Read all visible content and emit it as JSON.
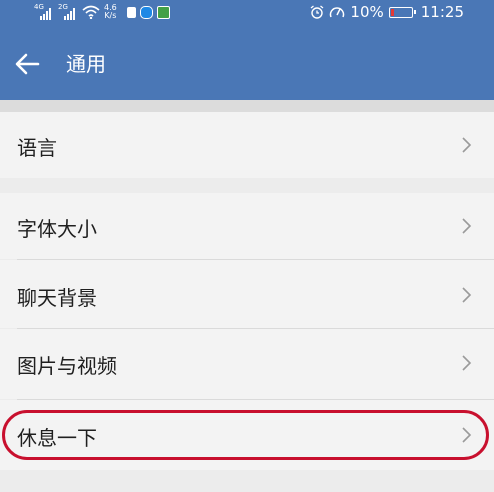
{
  "status_bar": {
    "net1": "4G",
    "net2": "2G",
    "speed_top": "4.6",
    "speed_bottom": "K/s",
    "battery_text": "10%",
    "time": "11:25",
    "icons": [
      "signal-icon",
      "signal-icon",
      "wifi-icon",
      "app-icon",
      "shield-app-icon",
      "play-app-icon",
      "alarm-icon",
      "speedometer-icon",
      "battery-icon"
    ],
    "accent": "#4a77b6",
    "battery_color": "#e53935"
  },
  "header": {
    "title": "通用",
    "back_icon": "arrow-left-icon"
  },
  "settings": {
    "items": [
      {
        "label": "语言"
      },
      {
        "label": "字体大小"
      },
      {
        "label": "聊天背景"
      },
      {
        "label": "图片与视频"
      },
      {
        "label": "休息一下"
      }
    ],
    "chevron_icon": "chevron-right-icon",
    "highlight_color": "#c8102e"
  }
}
